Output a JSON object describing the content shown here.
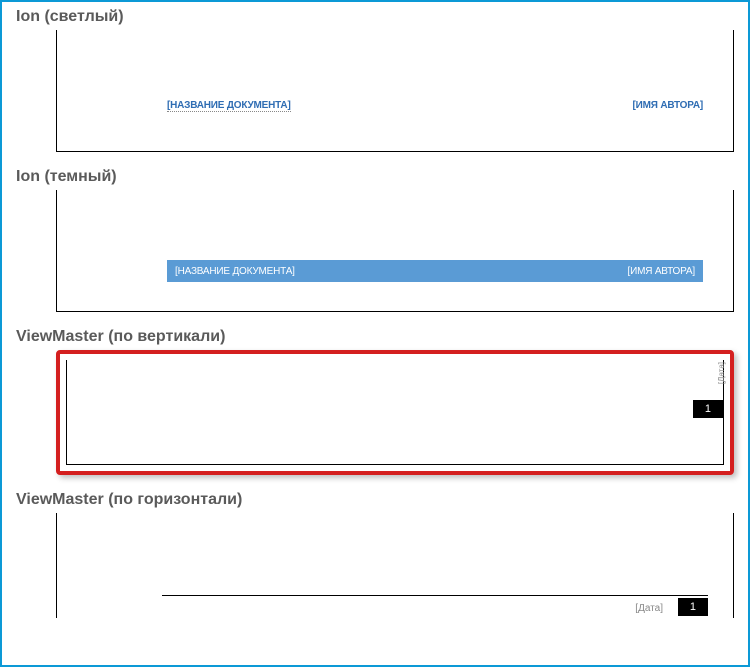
{
  "sections": {
    "ion_light": {
      "title": "Ion (светлый)",
      "doc_title_placeholder": "[НАЗВАНИЕ ДОКУМЕНТА]",
      "author_placeholder": "[ИМЯ АВТОРА]"
    },
    "ion_dark": {
      "title": "Ion (темный)",
      "doc_title_placeholder": "[НАЗВАНИЕ ДОКУМЕНТА]",
      "author_placeholder": "[ИМЯ АВТОРА]"
    },
    "vm_vertical": {
      "title": "ViewMaster (по вертикали)",
      "date_placeholder": "[Дата]",
      "page_number": "1"
    },
    "vm_horizontal": {
      "title": "ViewMaster (по горизонтали)",
      "date_placeholder": "[Дата]",
      "page_number": "1"
    }
  }
}
